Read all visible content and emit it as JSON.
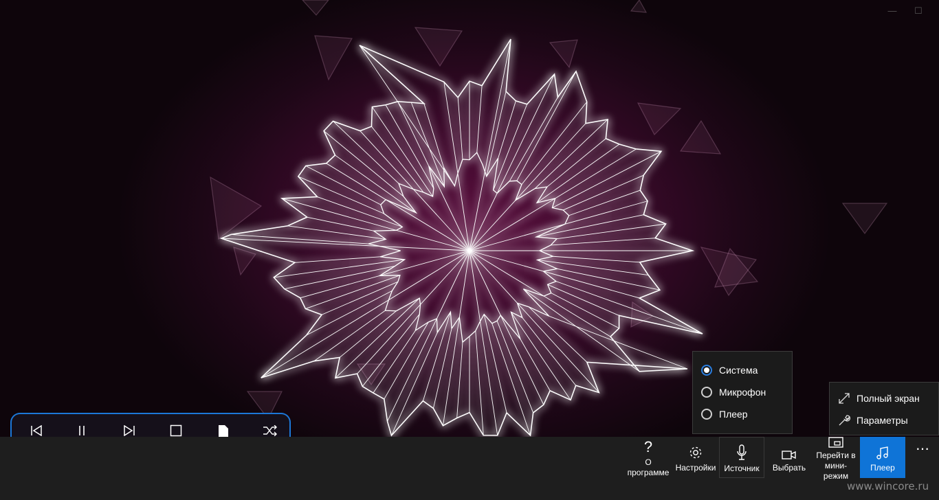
{
  "visualizer": {
    "name": "sound-visualizer"
  },
  "player_controls": [
    {
      "name": "previous-track-button",
      "icon": "previous-icon"
    },
    {
      "name": "pause-button",
      "icon": "pause-icon"
    },
    {
      "name": "next-track-button",
      "icon": "next-icon"
    },
    {
      "name": "stop-button",
      "icon": "stop-icon"
    },
    {
      "name": "save-button",
      "icon": "file-icon"
    },
    {
      "name": "shuffle-button",
      "icon": "shuffle-icon"
    }
  ],
  "source_menu": {
    "options": [
      {
        "label": "Система",
        "selected": true
      },
      {
        "label": "Микрофон",
        "selected": false
      },
      {
        "label": "Плеер",
        "selected": false
      }
    ]
  },
  "more_menu": {
    "items": [
      {
        "label": "Полный экран",
        "icon": "fullscreen-icon"
      },
      {
        "label": "Параметры",
        "icon": "wrench-icon"
      }
    ]
  },
  "appbar": {
    "about_label": "О программе",
    "settings_label": "Настройки",
    "source_label": "Источник",
    "choose_label": "Выбрать",
    "mini_label": "Перейти в мини-режим",
    "player_label": "Плеер",
    "more_label": "⋯"
  },
  "colors": {
    "accent": "#0f74d7",
    "glow": "#ff9be0",
    "background": "#3d0a2c"
  },
  "watermark": "www.wincore.ru"
}
